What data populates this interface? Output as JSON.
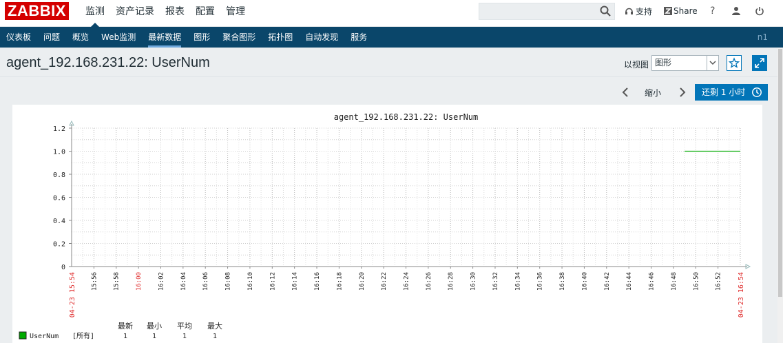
{
  "brand": {
    "logo_text": "ZABBIX",
    "color": "#d40000"
  },
  "main_nav": [
    {
      "label": "监测",
      "active": true
    },
    {
      "label": "资产记录"
    },
    {
      "label": "报表"
    },
    {
      "label": "配置"
    },
    {
      "label": "管理"
    }
  ],
  "top_right": {
    "support_label": "支持",
    "share_label": "Share",
    "help_label": "?"
  },
  "sub_nav": [
    {
      "label": "仪表板"
    },
    {
      "label": "问题"
    },
    {
      "label": "概览"
    },
    {
      "label": "Web监测"
    },
    {
      "label": "最新数据",
      "active": true
    },
    {
      "label": "图形"
    },
    {
      "label": "聚合图形"
    },
    {
      "label": "拓扑图"
    },
    {
      "label": "自动发现"
    },
    {
      "label": "服务"
    }
  ],
  "node_label": "n1",
  "page": {
    "title": "agent_192.168.231.22: UserNum",
    "view_as_label": "以视图",
    "view_as_value": "图形"
  },
  "time_controls": {
    "zoom_out_label": "缩小",
    "reset_label": "还剩 1 小时"
  },
  "colors": {
    "accent": "#0275b8",
    "subnav_bg": "#0a466a",
    "series": "#00aa00",
    "time_label": "#e03030"
  },
  "chart_data": {
    "type": "line",
    "title": "agent_192.168.231.22: UserNum",
    "ylim": [
      0,
      1.2
    ],
    "y_ticks": [
      "0",
      "0.2",
      "0.4",
      "0.6",
      "0.8",
      "1.0",
      "1.2"
    ],
    "x_start_label": "04-23 15:54",
    "x_end_label": "04-23 16:54",
    "x_tick_labels": [
      "15:56",
      "15:58",
      "16:00",
      "16:02",
      "16:04",
      "16:06",
      "16:08",
      "16:10",
      "16:12",
      "16:14",
      "16:16",
      "16:18",
      "16:20",
      "16:22",
      "16:24",
      "16:26",
      "16:28",
      "16:30",
      "16:32",
      "16:34",
      "16:36",
      "16:38",
      "16:40",
      "16:42",
      "16:44",
      "16:46",
      "16:48",
      "16:50",
      "16:52",
      "16:54"
    ],
    "x_highlight": [
      "16:00"
    ],
    "grid": true,
    "series": [
      {
        "name": "UserNum",
        "x_minutes": [
          55,
          60
        ],
        "values": [
          1,
          1
        ]
      }
    ],
    "legend": {
      "headers": [
        "最新",
        "最小",
        "平均",
        "最大"
      ],
      "rows": [
        {
          "name": "UserNum",
          "scope": "[所有]",
          "last": "1",
          "min": "1",
          "avg": "1",
          "max": "1"
        }
      ]
    }
  }
}
